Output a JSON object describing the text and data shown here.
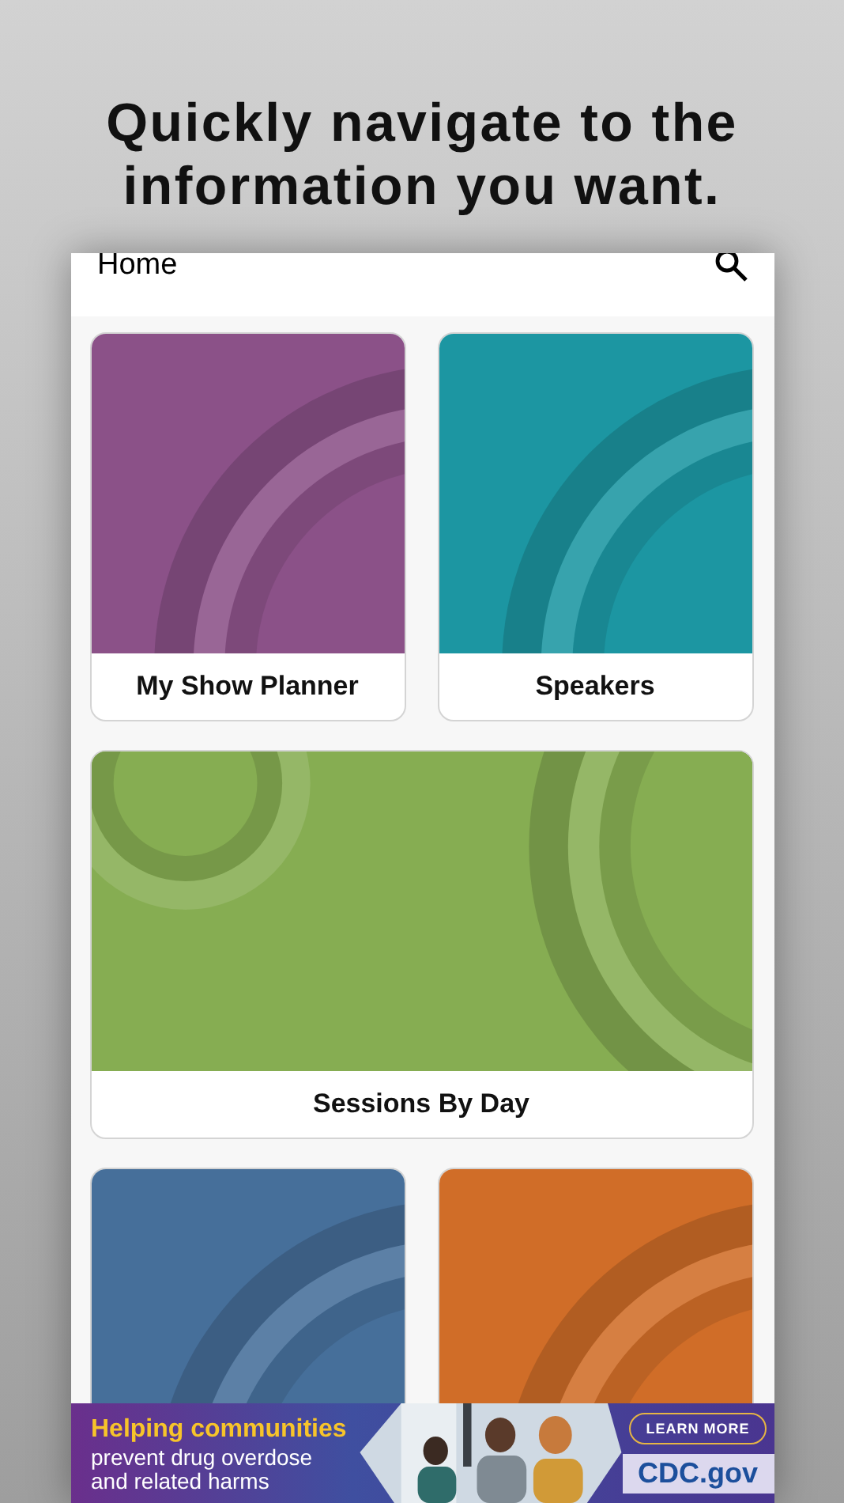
{
  "headline": "Quickly navigate to the information you want.",
  "header": {
    "title": "Home"
  },
  "tiles": [
    {
      "kind": "half",
      "label": "My Show Planner",
      "color": "#8b5188"
    },
    {
      "kind": "half",
      "label": "Speakers",
      "color": "#1c96a2"
    },
    {
      "kind": "wide",
      "label": "Sessions By Day",
      "color": "#86ad52"
    },
    {
      "kind": "half",
      "color": "#466f9a"
    },
    {
      "kind": "half",
      "color": "#d06d28"
    }
  ],
  "ad": {
    "headline": "Helping communities",
    "lines": [
      "prevent drug overdose",
      "and related harms"
    ],
    "button": "LEARN MORE",
    "site": "CDC.gov"
  }
}
